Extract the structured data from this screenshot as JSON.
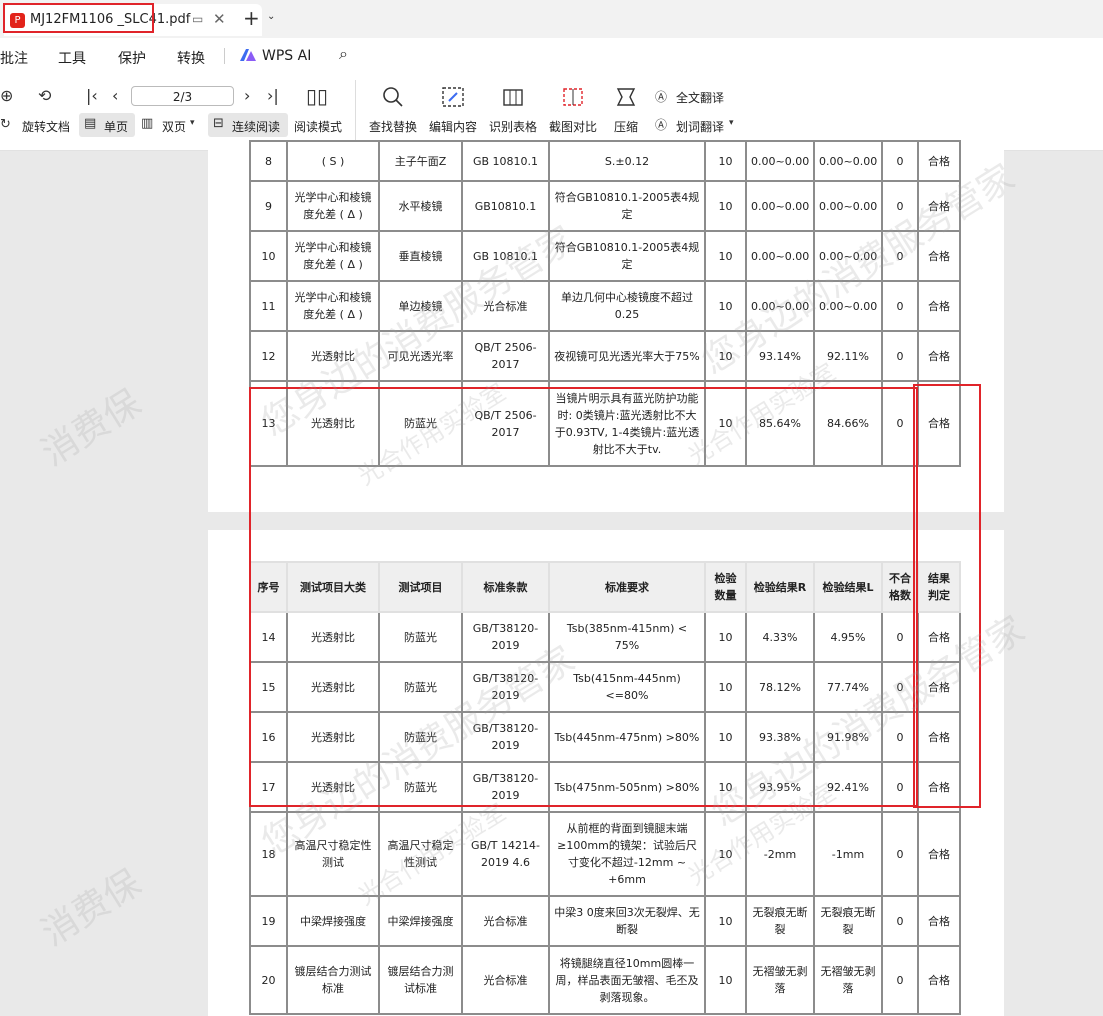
{
  "tab": {
    "title": "MJ12FM1106 _SLC41.pdf",
    "logo_text": "P"
  },
  "menu": [
    "批注",
    "工具",
    "保护",
    "转换",
    "WPS AI"
  ],
  "toolbar": {
    "rotate_label": "旋转文档",
    "single_label": "单页",
    "double_label": "双页",
    "continuous_label": "连续阅读",
    "read_mode_label": "阅读模式",
    "page_indicator": "2/3",
    "find_replace_label": "查找替换",
    "edit_content_label": "编辑内容",
    "recognize_table_label": "识别表格",
    "screenshot_compare_label": "截图对比",
    "compress_label": "压缩",
    "full_translate_label": "全文翻译",
    "word_translate_label": "划词翻译"
  },
  "table_headers": [
    "序号",
    "测试项目大类",
    "测试项目",
    "标准条款",
    "标准要求",
    "检验数量",
    "检验结果R",
    "检验结果L",
    "不合格数",
    "结果判定"
  ],
  "rows_page1": [
    [
      "8",
      "( S )",
      "主子午面Z",
      "GB 10810.1",
      "S.±0.12",
      "10",
      "0.00~0.00",
      "0.00~0.00",
      "0",
      "合格"
    ],
    [
      "9",
      "光学中心和棱镜度允差 ( Δ )",
      "水平棱镜",
      "GB10810.1",
      "符合GB10810.1-2005表4规定",
      "10",
      "0.00~0.00",
      "0.00~0.00",
      "0",
      "合格"
    ],
    [
      "10",
      "光学中心和棱镜度允差 ( Δ )",
      "垂直棱镜",
      "GB 10810.1",
      "符合GB10810.1-2005表4规定",
      "10",
      "0.00~0.00",
      "0.00~0.00",
      "0",
      "合格"
    ],
    [
      "11",
      "光学中心和棱镜度允差 ( Δ )",
      "单边棱镜",
      "光合标准",
      "单边几何中心棱镜度不超过0.25",
      "10",
      "0.00~0.00",
      "0.00~0.00",
      "0",
      "合格"
    ],
    [
      "12",
      "光透射比",
      "可见光透光率",
      "QB/T 2506-2017",
      "夜视镜可见光透光率大于75%",
      "10",
      "93.14%",
      "92.11%",
      "0",
      "合格"
    ],
    [
      "13",
      "光透射比",
      "防蓝光",
      "QB/T 2506-2017",
      "当镜片明示具有蓝光防护功能时: 0类镜片:蓝光透射比不大于0.93TV, 1-4类镜片:蓝光透射比不大于tv.",
      "10",
      "85.64%",
      "84.66%",
      "0",
      "合格"
    ]
  ],
  "rows_page2": [
    [
      "14",
      "光透射比",
      "防蓝光",
      "GB/T38120-2019",
      "Tsb(385nm-415nm) < 75%",
      "10",
      "4.33%",
      "4.95%",
      "0",
      "合格"
    ],
    [
      "15",
      "光透射比",
      "防蓝光",
      "GB/T38120-2019",
      "Tsb(415nm-445nm) <=80%",
      "10",
      "78.12%",
      "77.74%",
      "0",
      "合格"
    ],
    [
      "16",
      "光透射比",
      "防蓝光",
      "GB/T38120-2019",
      "Tsb(445nm-475nm) >80%",
      "10",
      "93.38%",
      "91.98%",
      "0",
      "合格"
    ],
    [
      "17",
      "光透射比",
      "防蓝光",
      "GB/T38120-2019",
      "Tsb(475nm-505nm) >80%",
      "10",
      "93.95%",
      "92.41%",
      "0",
      "合格"
    ],
    [
      "18",
      "高温尺寸稳定性测试",
      "高温尺寸稳定性测试",
      "GB/T 14214-2019 4.6",
      "从前框的背面到镜腿末端≥100mm的镜架：试验后尺寸变化不超过-12mm ~ +6mm",
      "10",
      "-2mm",
      "-1mm",
      "0",
      "合格"
    ],
    [
      "19",
      "中梁焊接强度",
      "中梁焊接强度",
      "光合标准",
      "中梁3 0度来回3次无裂焊、无断裂",
      "10",
      "无裂痕无断裂",
      "无裂痕无断裂",
      "0",
      "合格"
    ],
    [
      "20",
      "镀层结合力测试标准",
      "镀层结合力测试标准",
      "光合标准",
      "将镜腿绕直径10mm圆棒一周，样品表面无皱褶、毛丕及剥落现象。",
      "10",
      "无褶皱无剥落",
      "无褶皱无剥落",
      "0",
      "合格"
    ]
  ],
  "watermarks": [
    "消费保",
    "您身边的消费服务管家",
    "光合作用实验室"
  ],
  "colors": {
    "highlight": "#e0242a",
    "tab_logo": "#e2231a",
    "border": "#8c8c8c"
  }
}
